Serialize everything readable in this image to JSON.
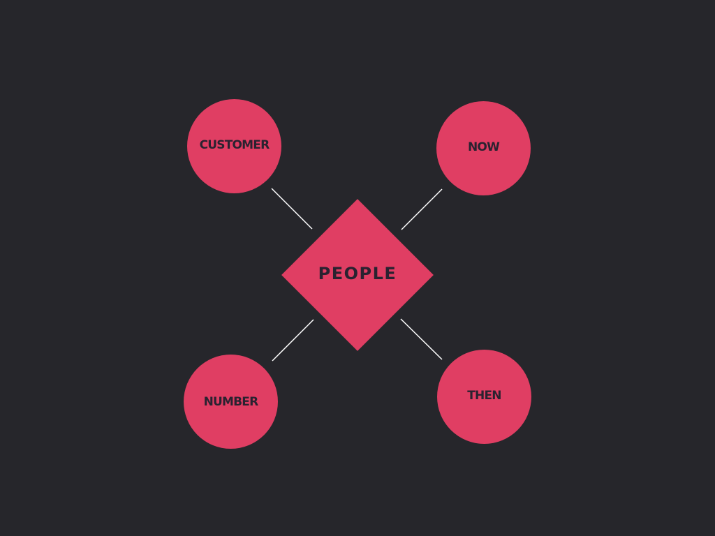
{
  "diagram": {
    "center": {
      "label": "PEOPLE"
    },
    "nodes": [
      {
        "label": "CUSTOMER"
      },
      {
        "label": "NOW"
      },
      {
        "label": "NUMBER"
      },
      {
        "label": "THEN"
      }
    ]
  },
  "colors": {
    "background": "#26262b",
    "shape_fill": "#e03e63",
    "label_text": "#2a2230",
    "connector": "#ffffff"
  }
}
